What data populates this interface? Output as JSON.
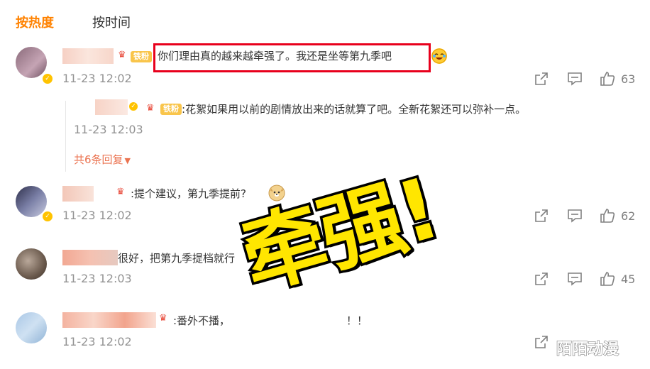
{
  "tabs": [
    {
      "label": "按热度",
      "active": true
    },
    {
      "label": "按时间",
      "active": false
    }
  ],
  "colors": {
    "accent": "#ff8200",
    "reply_link": "#eb7350",
    "highlight_box": "#e8001c",
    "overlay_text": "#ffe600"
  },
  "comments": [
    {
      "fan_badge": "铁粉",
      "text": "你们理由真的越来越牵强了。我还是坐等第九季吧",
      "time": "11-23 12:02",
      "likes": "63",
      "emoji": "laughing-crying-emoji",
      "reply": {
        "prefix": ":",
        "fan_badge": "铁粉",
        "text": "花絮如果用以前的剧情放出来的话就算了吧。全新花絮还可以弥补一点。",
        "time": "11-23 12:03"
      },
      "more_replies": "共6条回复"
    },
    {
      "text": ":提个建议，第九季提前?",
      "time": "11-23 12:02",
      "likes": "62",
      "emoji": "doge-emoji"
    },
    {
      "text": "很好，把第九季提档就行",
      "time": "11-23 12:03",
      "likes": "45"
    },
    {
      "text": ":番外不播，",
      "text_tail": "！！",
      "time": "11-23 12:02"
    }
  ],
  "overlay": {
    "big_text": "牵强!"
  },
  "watermark": "陌陌动漫"
}
